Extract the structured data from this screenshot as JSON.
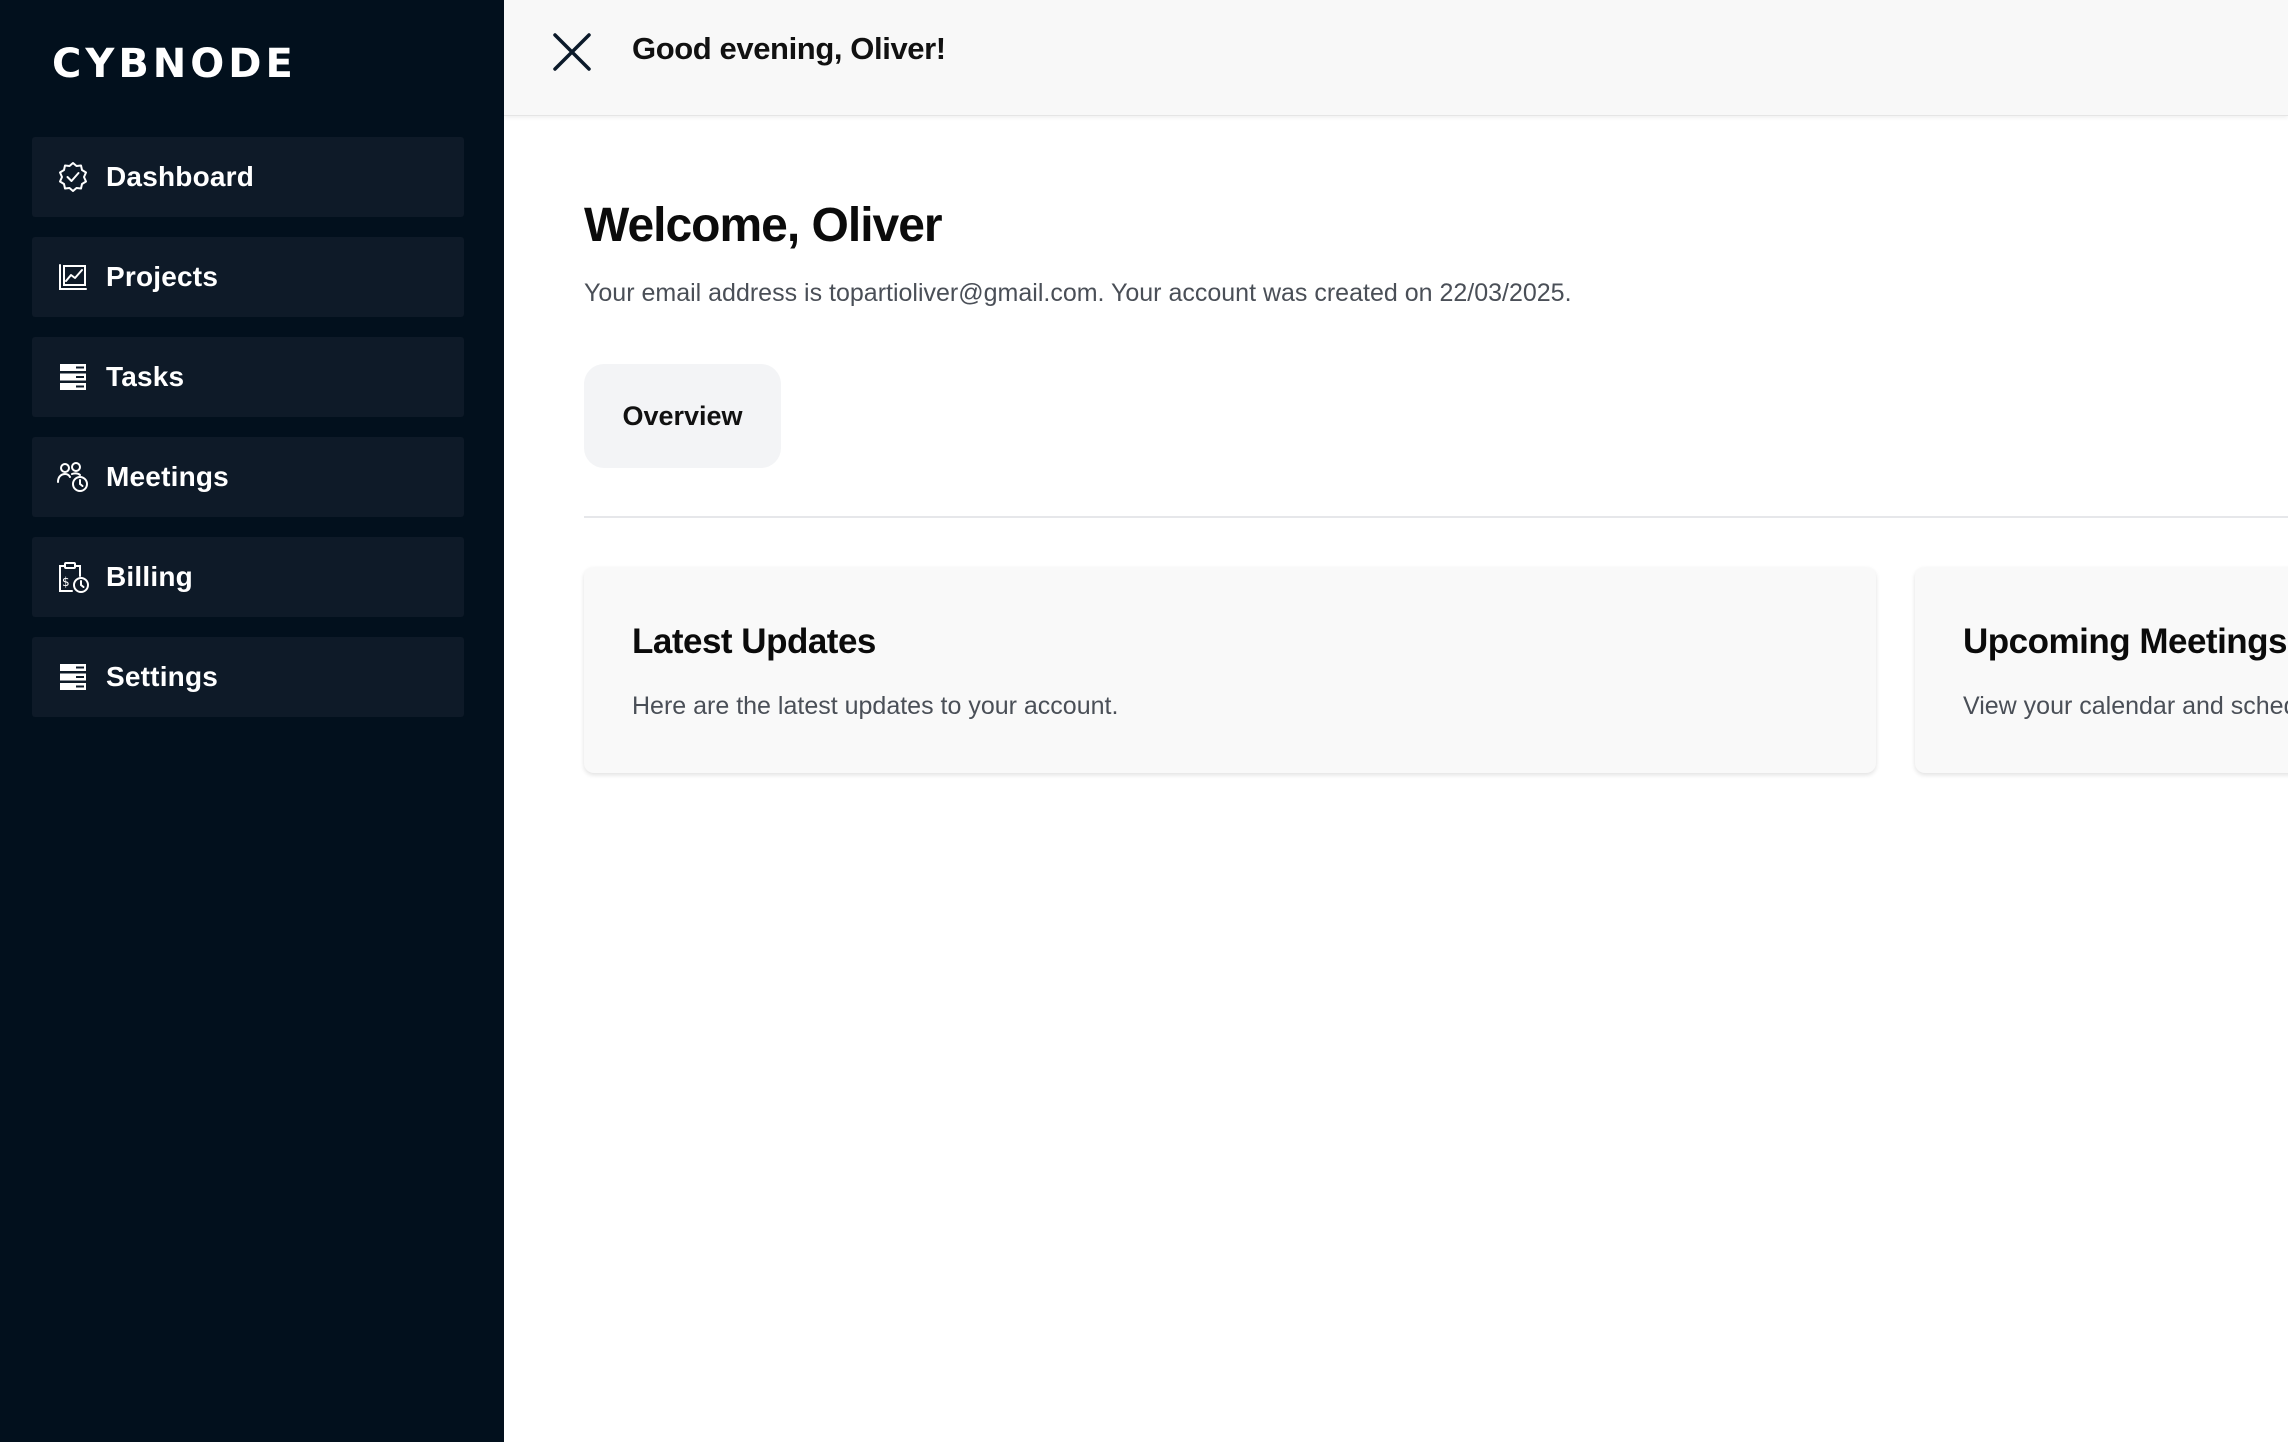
{
  "brand": {
    "logo_text": "CYBNODE"
  },
  "sidebar": {
    "items": [
      {
        "label": "Dashboard",
        "icon": "badge-check-icon"
      },
      {
        "label": "Projects",
        "icon": "chart-icon"
      },
      {
        "label": "Tasks",
        "icon": "server-icon"
      },
      {
        "label": "Meetings",
        "icon": "users-clock-icon"
      },
      {
        "label": "Billing",
        "icon": "clipboard-dollar-icon"
      },
      {
        "label": "Settings",
        "icon": "server-icon"
      }
    ]
  },
  "header": {
    "greeting": "Good evening, Oliver!",
    "close_icon": "close-icon"
  },
  "main": {
    "title": "Welcome, Oliver",
    "account_info": "Your email address is topartioliver@gmail.com. Your account was created on 22/03/2025.",
    "tabs": [
      {
        "label": "Overview"
      }
    ],
    "cards": [
      {
        "title": "Latest Updates",
        "description": "Here are the latest updates to your account."
      },
      {
        "title": "Upcoming Meetings",
        "description": "View your calendar and schedule."
      }
    ]
  },
  "colors": {
    "sidebar_bg": "#02101d",
    "nav_item_bg": "#0e1a28",
    "topbar_bg": "#f8f8f8",
    "card_bg": "#f9f9f9",
    "tab_bg": "#f3f4f6",
    "text_primary": "#0b0b0b",
    "text_secondary": "#4a4f57"
  }
}
